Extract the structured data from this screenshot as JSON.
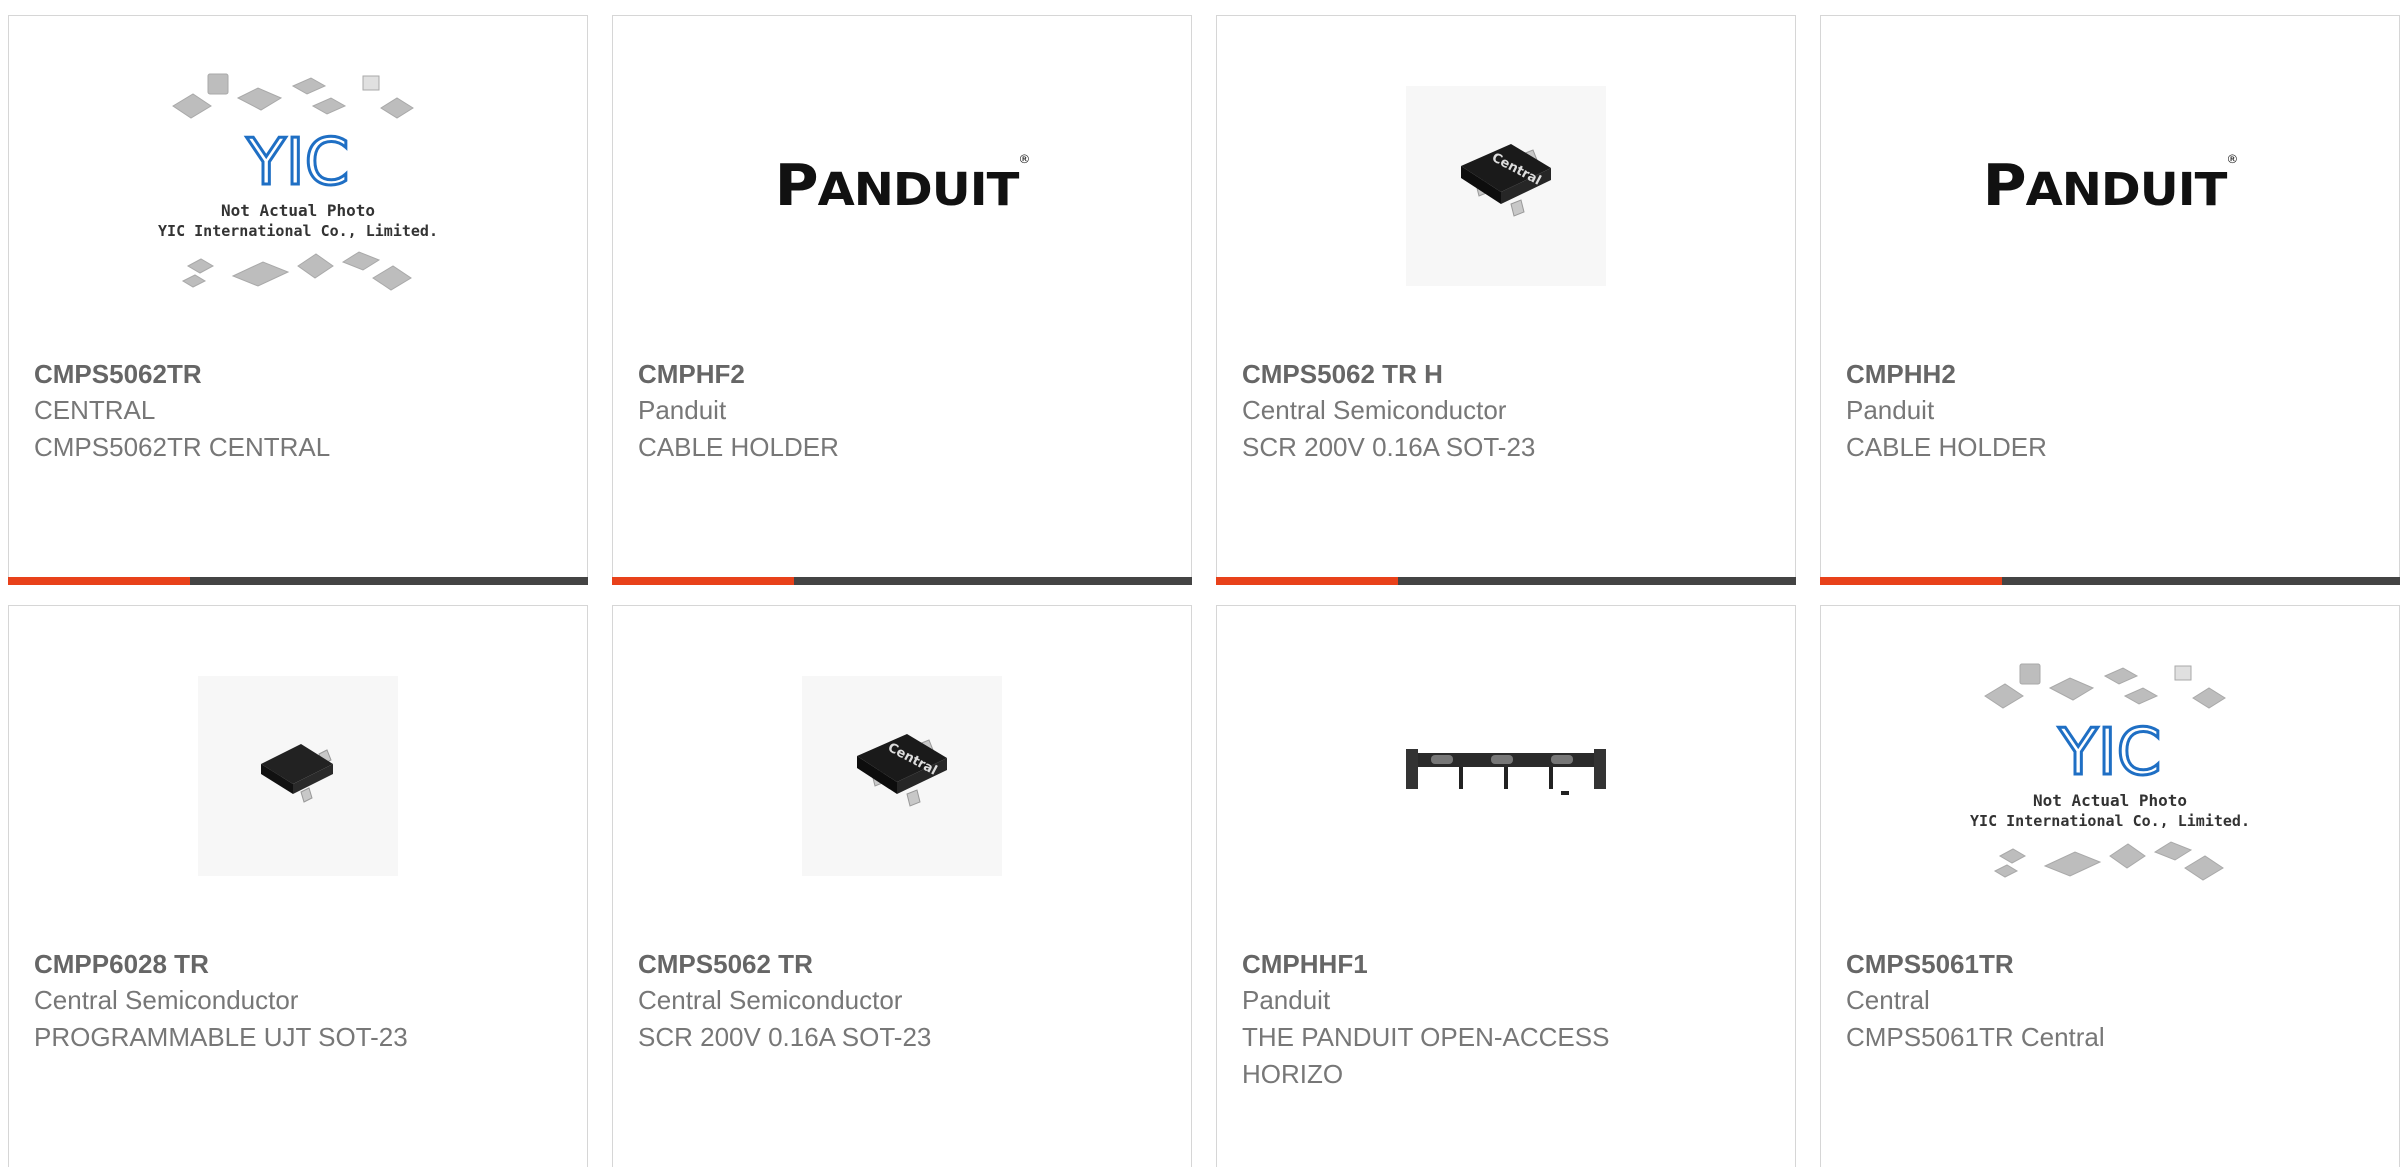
{
  "products": [
    {
      "part_number": "CMPS5062TR",
      "manufacturer": "CENTRAL",
      "description": "CMPS5062TR CENTRAL",
      "image_type": "placeholder",
      "placeholder_line1": "Not Actual Photo",
      "placeholder_line2": "YIC International Co., Limited.",
      "placeholder_logo": "YIC"
    },
    {
      "part_number": "CMPHF2",
      "manufacturer": "Panduit",
      "description": "CABLE HOLDER",
      "image_type": "panduit-logo",
      "logo_first": "P",
      "logo_rest": "ANDUIT",
      "logo_mark": "®"
    },
    {
      "part_number": "CMPS5062 TR H",
      "manufacturer": "Central Semiconductor",
      "description": "SCR 200V 0.16A SOT-23",
      "image_type": "sot23-central",
      "chip_marking": "Central"
    },
    {
      "part_number": "CMPHH2",
      "manufacturer": "Panduit",
      "description": "CABLE HOLDER",
      "image_type": "panduit-logo",
      "logo_first": "P",
      "logo_rest": "ANDUIT",
      "logo_mark": "®"
    },
    {
      "part_number": "CMPP6028 TR",
      "manufacturer": "Central Semiconductor",
      "description": "PROGRAMMABLE UJT SOT-23",
      "image_type": "sot23-blank"
    },
    {
      "part_number": "CMPS5062 TR",
      "manufacturer": "Central Semiconductor",
      "description": "SCR 200V 0.16A SOT-23",
      "image_type": "sot23-central",
      "chip_marking": "Central"
    },
    {
      "part_number": "CMPHHF1",
      "manufacturer": "Panduit",
      "description": "THE PANDUIT OPEN-ACCESS HORIZO",
      "image_type": "cable-manager"
    },
    {
      "part_number": "CMPS5061TR",
      "manufacturer": "Central",
      "description": "CMPS5061TR Central",
      "image_type": "placeholder",
      "placeholder_line1": "Not Actual Photo",
      "placeholder_line2": "YIC International Co., Limited.",
      "placeholder_logo": "YIC"
    }
  ],
  "colors": {
    "accent_bar": "#e8411a",
    "dark_bar": "#444444",
    "text": "#777777",
    "border": "#d6d6d6"
  }
}
